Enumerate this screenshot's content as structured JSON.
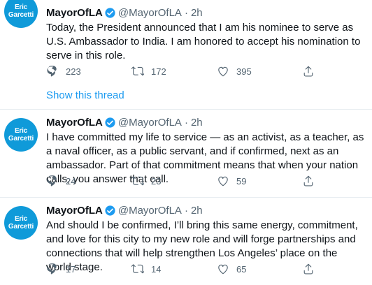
{
  "tweets": [
    {
      "avatar_lines": [
        "Eric",
        "Garcetti"
      ],
      "name": "MayorOfLA",
      "handle": "@MayorOfLA",
      "time": "2h",
      "text": "Today, the President announced that I am his nominee to serve as U.S. Ambassador to India. I am honored to accept his nomination to serve in this role.",
      "replies": "223",
      "retweets": "172",
      "likes": "395"
    },
    {
      "avatar_lines": [
        "Eric",
        "Garcetti"
      ],
      "name": "MayorOfLA",
      "handle": "@MayorOfLA",
      "time": "2h",
      "text": "I have committed my life to service — as an activist, as a teacher, as a naval officer, as a public servant, and if confirmed, next as an ambassador. Part of that commitment means that when your nation calls, you answer that call.",
      "replies": "24",
      "retweets": "23",
      "likes": "59"
    },
    {
      "avatar_lines": [
        "Eric",
        "Garcetti"
      ],
      "name": "MayorOfLA",
      "handle": "@MayorOfLA",
      "time": "2h",
      "text": "And should I be confirmed, I’ll bring this same energy, commitment, and love for this city to my new role and will forge partnerships and connections that will help strengthen Los Angeles’ place on the world stage.",
      "replies": "17",
      "retweets": "14",
      "likes": "65"
    }
  ],
  "show_thread_label": "Show this thread",
  "separator": "·",
  "colors": {
    "accent": "#1d9bf0",
    "avatar_bg": "#0f9ad9",
    "muted": "#536471",
    "text": "#0f1419"
  }
}
